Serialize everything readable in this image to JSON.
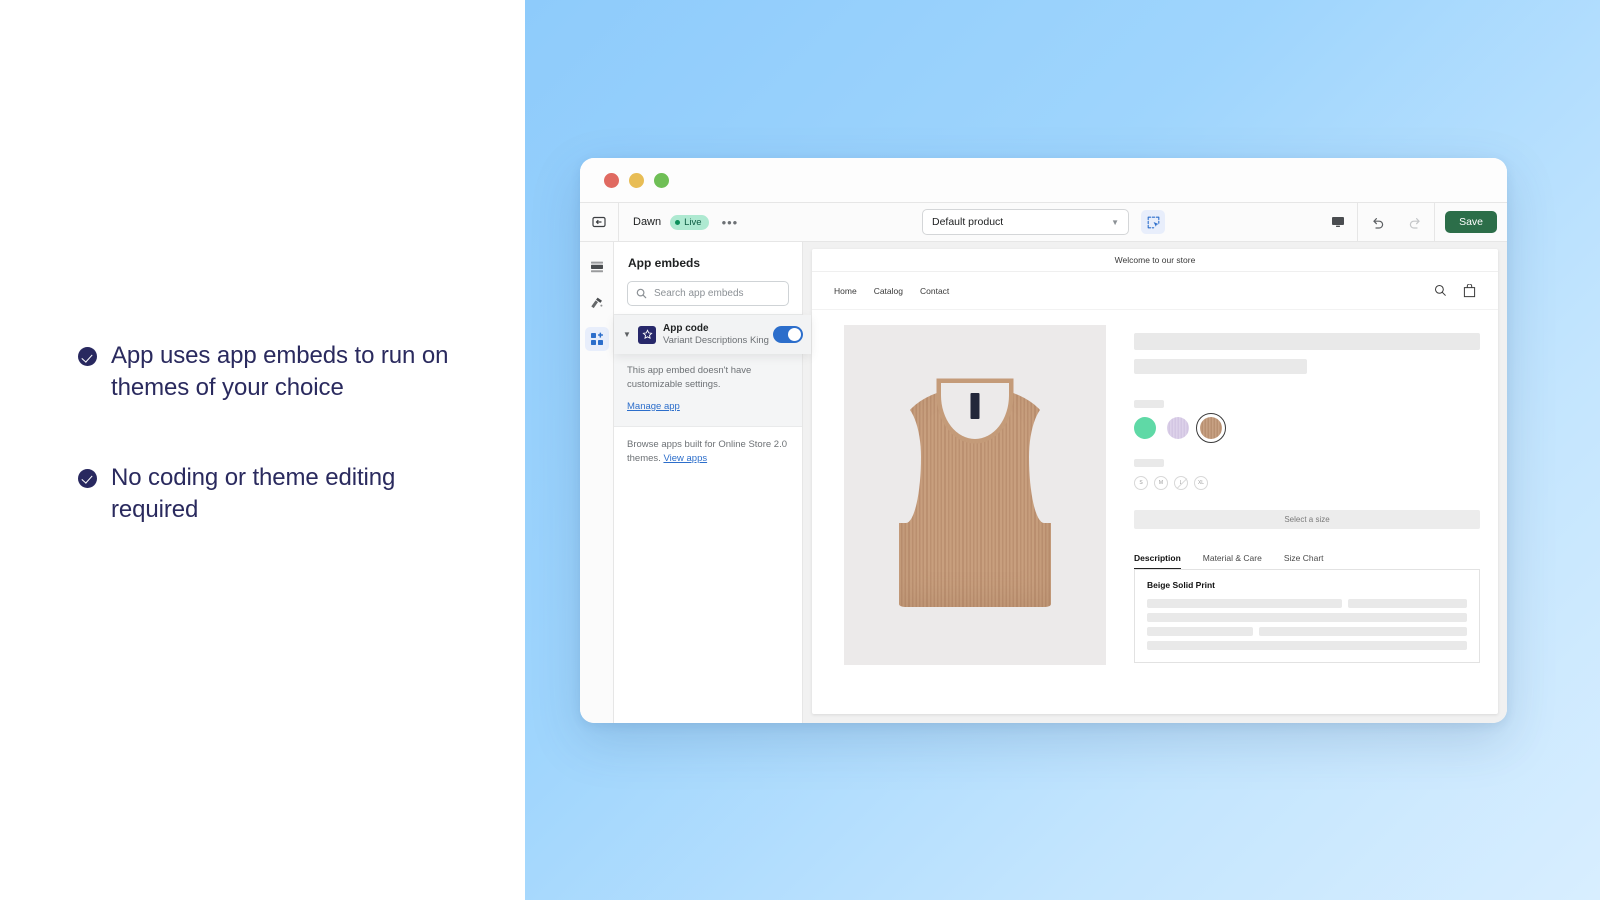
{
  "marketing": {
    "bullets": [
      {
        "icon": "check-circle-icon",
        "text": "App uses app embeds to run on themes of your choice"
      },
      {
        "icon": "check-circle-icon",
        "text": "No coding or theme editing required"
      }
    ]
  },
  "window": {
    "traffic_lights": [
      "close",
      "minimize",
      "maximize"
    ],
    "toolbar": {
      "back_icon": "exit-editor-icon",
      "theme_name": "Dawn",
      "live_badge": "Live",
      "more_label": "•••",
      "product_selector": {
        "value": "Default product",
        "caret_icon": "chevron-down-icon"
      },
      "inspect_icon": "section-selector-icon",
      "device_icon": "desktop-preview-icon",
      "undo_icon": "undo-icon",
      "redo_icon": "redo-icon",
      "save_label": "Save"
    },
    "rail": [
      {
        "icon": "sections-icon",
        "name": "sections",
        "active": false
      },
      {
        "icon": "theme-settings-icon",
        "name": "theme-settings",
        "active": false
      },
      {
        "icon": "app-embeds-icon",
        "name": "app-embeds",
        "active": true
      }
    ],
    "panel": {
      "title": "App embeds",
      "search": {
        "placeholder": "Search app embeds",
        "icon": "search-icon"
      },
      "embed": {
        "disclosure_icon": "triangle-down-icon",
        "app_icon": "star-app-icon",
        "name": "App code",
        "subtitle": "Variant Descriptions King",
        "toggle_state": "on",
        "note": "This app embed doesn't have customizable settings.",
        "manage_link": "Manage app"
      },
      "footer": {
        "text": "Browse apps built for Online Store 2.0 themes.",
        "link": "View apps"
      }
    },
    "preview": {
      "announcement": "Welcome to our store",
      "nav": [
        "Home",
        "Catalog",
        "Contact"
      ],
      "nav_icons": [
        "search-icon",
        "cart-icon"
      ],
      "product": {
        "image_alt": "beige-ribbed-tank-top",
        "color_swatches": [
          {
            "name": "green",
            "hex": "#5fd9a6",
            "selected": false
          },
          {
            "name": "lilac",
            "hex": "#d3c6e3",
            "selected": false
          },
          {
            "name": "beige",
            "hex": "#b89071",
            "selected": true
          }
        ],
        "sizes": [
          {
            "label": "S",
            "available": true
          },
          {
            "label": "M",
            "available": true
          },
          {
            "label": "L",
            "available": false
          },
          {
            "label": "XL",
            "available": true
          }
        ],
        "cta_label": "Select a size",
        "tabs": [
          {
            "label": "Description",
            "active": true
          },
          {
            "label": "Material & Care",
            "active": false
          },
          {
            "label": "Size Chart",
            "active": false
          }
        ],
        "tab_content_heading": "Beige Solid Print"
      }
    }
  },
  "colors": {
    "accent_blue": "#2c6ecb",
    "save_green": "#2c6e49",
    "navy": "#28285f",
    "live_badge_bg": "#aee9d1",
    "stage_gradient_from": "#8ecbfb",
    "stage_gradient_to": "#d8eeff"
  }
}
